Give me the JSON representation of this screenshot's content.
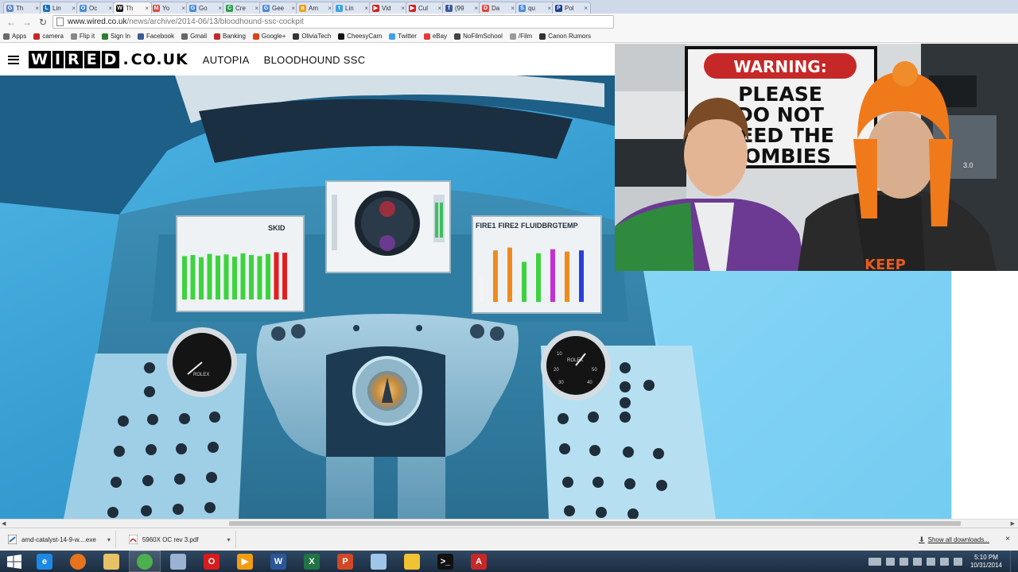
{
  "browser": {
    "tabs": [
      {
        "label": "Th",
        "fav_color": "#5f86c4",
        "fav_glyph": "G"
      },
      {
        "label": "Lin",
        "fav_color": "#1b6fb5",
        "fav_glyph": "L"
      },
      {
        "label": "Oc",
        "fav_color": "#4a8bd6",
        "fav_glyph": "O"
      },
      {
        "label": "Th",
        "fav_color": "#111111",
        "fav_glyph": "W",
        "active": true
      },
      {
        "label": "Yo",
        "fav_color": "#d54b3d",
        "fav_glyph": "M"
      },
      {
        "label": "Go",
        "fav_color": "#4a8bd6",
        "fav_glyph": "G"
      },
      {
        "label": "Cre",
        "fav_color": "#2e9b49",
        "fav_glyph": "C"
      },
      {
        "label": "Gee",
        "fav_color": "#4a8bd6",
        "fav_glyph": "G"
      },
      {
        "label": "Am",
        "fav_color": "#f0a01b",
        "fav_glyph": "a"
      },
      {
        "label": "Lin",
        "fav_color": "#3ea1e6",
        "fav_glyph": "t"
      },
      {
        "label": "Vid",
        "fav_color": "#d21f1f",
        "fav_glyph": "▶"
      },
      {
        "label": "Cul",
        "fav_color": "#d21f1f",
        "fav_glyph": "▶"
      },
      {
        "label": "(99",
        "fav_color": "#3b5998",
        "fav_glyph": "f"
      },
      {
        "label": "Da",
        "fav_color": "#d54b3d",
        "fav_glyph": "D"
      },
      {
        "label": "qu",
        "fav_color": "#4a8bd6",
        "fav_glyph": "S"
      },
      {
        "label": "Pol",
        "fav_color": "#1f3f8a",
        "fav_glyph": "P"
      }
    ],
    "tab_close": "×",
    "url_domain": "www.wired.co.uk",
    "url_path": "/news/archive/2014-06/13/bloodhound-ssc-cockpit",
    "bookmarks": [
      {
        "label": "Apps",
        "color": "#6a6a6a"
      },
      {
        "label": "camera",
        "color": "#c62828"
      },
      {
        "label": "Flip it",
        "color": "#888888"
      },
      {
        "label": "Sign In",
        "color": "#2e7d32"
      },
      {
        "label": "Facebook",
        "color": "#3b5998"
      },
      {
        "label": "Gmail",
        "color": "#666666"
      },
      {
        "label": "Banking",
        "color": "#c62828"
      },
      {
        "label": "Google+",
        "color": "#d84315"
      },
      {
        "label": "OliviaTech",
        "color": "#333333"
      },
      {
        "label": "CheesyCam",
        "color": "#111111"
      },
      {
        "label": "Twitter",
        "color": "#3ea1e6"
      },
      {
        "label": "eBay",
        "color": "#e53935"
      },
      {
        "label": "NoFilmSchool",
        "color": "#444444"
      },
      {
        "label": "/Film",
        "color": "#999999"
      },
      {
        "label": "Canon Rumors",
        "color": "#333333"
      }
    ]
  },
  "site": {
    "logo_letters": [
      "W",
      "I",
      "R",
      "E",
      "D"
    ],
    "logo_domain": "CO.UK",
    "logo_dot": ".",
    "nav": [
      "AUTOPIA",
      "BLOODHOUND SSC"
    ]
  },
  "cockpit": {
    "left_panel_labels": [
      "SKID"
    ],
    "right_panel_labels": [
      "FIRE1",
      "FIRE2",
      "FLUID",
      "BRG",
      "TEMP"
    ],
    "left_bar_levels": [
      0.78,
      0.8,
      0.76,
      0.82,
      0.79,
      0.81,
      0.77,
      0.83,
      0.8,
      0.78,
      0.82,
      0.85,
      0.84
    ],
    "left_bar_colors": [
      "#3fd23f",
      "#3fd23f",
      "#3fd23f",
      "#3fd23f",
      "#3fd23f",
      "#3fd23f",
      "#3fd23f",
      "#3fd23f",
      "#3fd23f",
      "#3fd23f",
      "#3fd23f",
      "#e02020",
      "#e02020"
    ],
    "right_bar_levels": [
      0.45,
      0.9,
      0.95,
      0.7,
      0.85,
      0.92,
      0.88,
      0.9
    ],
    "right_bar_colors": [
      "#f4f4f4",
      "#f08a1e",
      "#f08a1e",
      "#3fd23f",
      "#3fd23f",
      "#c22fd6",
      "#f08a1e",
      "#2a3fd8"
    ],
    "gauge_brand": "ROLEX",
    "gauge_numbers": [
      "10",
      "20",
      "30",
      "40",
      "50"
    ]
  },
  "webcam": {
    "sign_title": "WARNING:",
    "sign_lines": [
      "PLEASE",
      "DO NOT",
      "FEED THE",
      "ZOMBIES"
    ],
    "shirt_text": "KEEP",
    "box_text": "3.0"
  },
  "downloads": {
    "items": [
      {
        "name": "amd-catalyst-14-9-w....exe",
        "type": "exe"
      },
      {
        "name": "5960X OC rev 3.pdf",
        "type": "pdf"
      }
    ],
    "show_all": "Show all downloads...",
    "close": "×"
  },
  "taskbar": {
    "apps": [
      {
        "name": "ie",
        "glyph": "e",
        "color": "#1e88e5"
      },
      {
        "name": "firefox",
        "glyph": "",
        "color": "#e8731d"
      },
      {
        "name": "explorer",
        "glyph": "",
        "color": "#e8c167"
      },
      {
        "name": "chrome",
        "glyph": "",
        "color": "#4caf50",
        "active": true
      },
      {
        "name": "photo",
        "glyph": "",
        "color": "#9bb3d3"
      },
      {
        "name": "opera",
        "glyph": "O",
        "color": "#d81b1b"
      },
      {
        "name": "vlc",
        "glyph": "▶",
        "color": "#f39c12"
      },
      {
        "name": "word",
        "glyph": "W",
        "color": "#2b579a"
      },
      {
        "name": "excel",
        "glyph": "X",
        "color": "#217346"
      },
      {
        "name": "powerpoint",
        "glyph": "P",
        "color": "#d24726"
      },
      {
        "name": "notepad",
        "glyph": "",
        "color": "#9fc6e8"
      },
      {
        "name": "wallet",
        "glyph": "",
        "color": "#f1c232"
      },
      {
        "name": "cmd",
        "glyph": ">_",
        "color": "#111111"
      },
      {
        "name": "acrobat",
        "glyph": "A",
        "color": "#c62828"
      }
    ],
    "time": "5:10 PM",
    "date": "10/31/2014"
  }
}
